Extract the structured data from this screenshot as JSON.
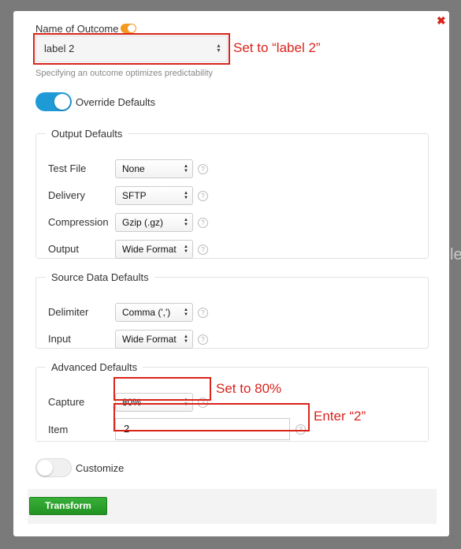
{
  "background": {
    "partial_text": "le"
  },
  "modal": {
    "close_glyph": "✖",
    "outcome": {
      "label": "Name of Outcome",
      "selected": "label 2",
      "hint": "Specifying an outcome optimizes predictability",
      "annotation": "Set to “label 2”"
    },
    "override_toggle": {
      "label": "Override Defaults",
      "on": true
    },
    "output_defaults": {
      "title": "Output Defaults",
      "rows": [
        {
          "label": "Test File",
          "value": "None"
        },
        {
          "label": "Delivery",
          "value": "SFTP"
        },
        {
          "label": "Compression",
          "value": "Gzip (.gz)"
        },
        {
          "label": "Output",
          "value": "Wide Format"
        }
      ]
    },
    "source_defaults": {
      "title": "Source Data Defaults",
      "rows": [
        {
          "label": "Delimiter",
          "value": "Comma (',')"
        },
        {
          "label": "Input",
          "value": "Wide Format"
        }
      ]
    },
    "advanced_defaults": {
      "title": "Advanced Defaults",
      "capture": {
        "label": "Capture",
        "value": "80%",
        "annotation": "Set to 80%"
      },
      "item": {
        "label": "Item",
        "value": "2",
        "annotation": "Enter “2”"
      }
    },
    "customize_toggle": {
      "label": "Customize",
      "on": false
    },
    "transform_button": "Transform",
    "help_glyph": "?",
    "colors": {
      "accent": "#1e9ad6",
      "annotation": "#d9241c",
      "button": "#2a9d2a",
      "mini_toggle": "#f39a1e"
    }
  }
}
